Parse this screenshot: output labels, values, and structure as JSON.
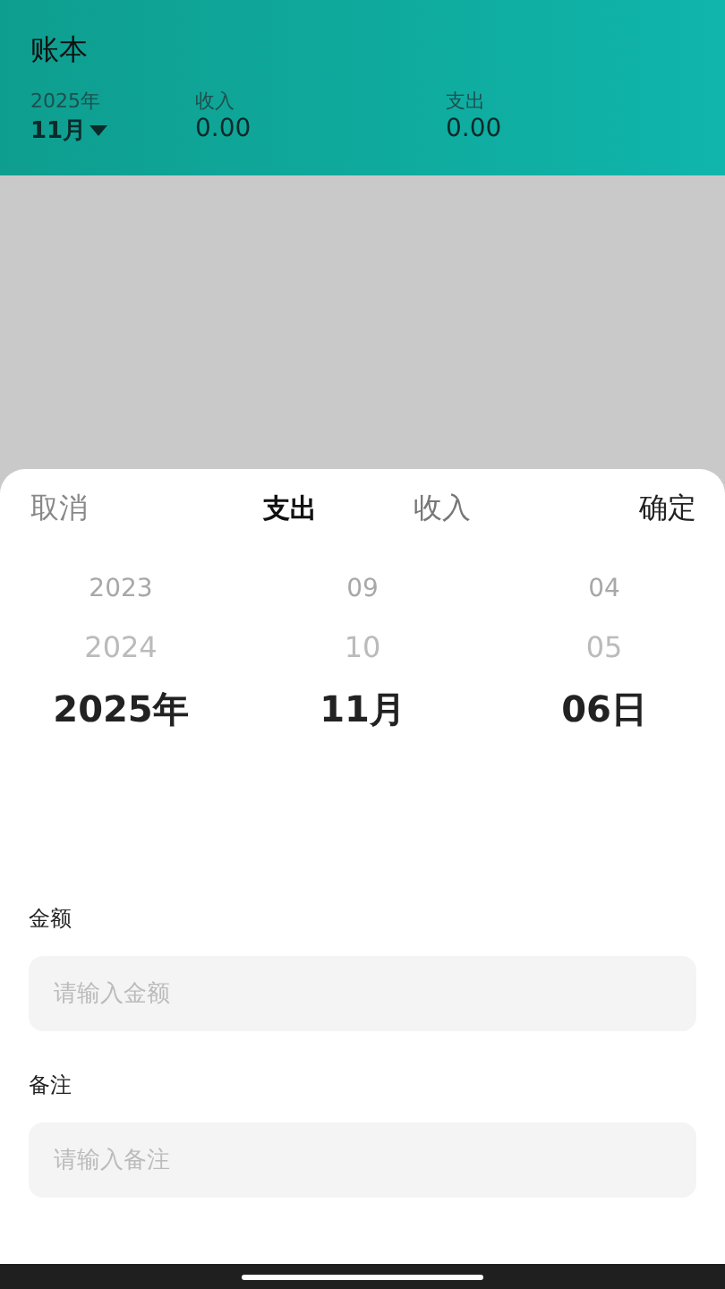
{
  "header": {
    "title": "账本",
    "year": "2025年",
    "month": "11月",
    "summary": [
      {
        "label": "收入",
        "value": "0.00"
      },
      {
        "label": "支出",
        "value": "0.00"
      }
    ]
  },
  "sheet": {
    "cancel": "取消",
    "tabs": [
      {
        "label": "支出",
        "selected": true
      },
      {
        "label": "收入",
        "selected": false
      }
    ],
    "confirm": "确定",
    "picker": [
      {
        "items": [
          {
            "text": "2023",
            "selected": false
          },
          {
            "text": "2024",
            "selected": false
          },
          {
            "text": "2025年",
            "selected": true
          }
        ]
      },
      {
        "items": [
          {
            "text": "09",
            "selected": false
          },
          {
            "text": "10",
            "selected": false
          },
          {
            "text": "11月",
            "selected": true
          }
        ]
      },
      {
        "items": [
          {
            "text": "04",
            "selected": false
          },
          {
            "text": "05",
            "selected": false
          },
          {
            "text": "06日",
            "selected": true
          }
        ]
      }
    ],
    "fields": [
      {
        "label": "金额",
        "placeholder": "请输入金额"
      },
      {
        "label": "备注",
        "placeholder": "请输入备注"
      }
    ]
  }
}
